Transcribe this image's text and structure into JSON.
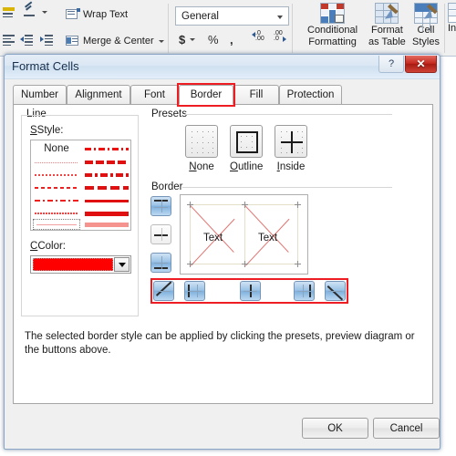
{
  "ribbon": {
    "alignment_group": {
      "orientation_label": "orientation-icon",
      "wrap_text": "Wrap Text",
      "merge_center": "Merge & Center",
      "decrease_indent": "decrease-indent-icon",
      "increase_indent": "increase-indent-icon",
      "align_left": "align-left-icon"
    },
    "number_group": {
      "format_value": "General",
      "currency": "$",
      "percent": "%",
      "comma": ",",
      "increase_decimal": ".00",
      "decrease_decimal": ".00"
    },
    "styles_group": {
      "conditional_formatting_line1": "Conditional",
      "conditional_formatting_line2": "Formatting",
      "format_as_table_line1": "Format",
      "format_as_table_line2": "as Table",
      "cell_styles_line1": "Cell",
      "cell_styles_line2": "Styles",
      "cells_group_partial": "In"
    }
  },
  "dialog": {
    "title": "Format Cells",
    "help_button": "?",
    "close_button": "✕",
    "tabs": [
      {
        "label": "Number",
        "selected": false
      },
      {
        "label": "Alignment",
        "selected": false
      },
      {
        "label": "Font",
        "selected": false
      },
      {
        "label": "Border",
        "selected": true
      },
      {
        "label": "Fill",
        "selected": false
      },
      {
        "label": "Protection",
        "selected": false
      }
    ],
    "line_group": {
      "title": "Line",
      "style_label": "Style:",
      "style_none": "None",
      "color_label": "Color:",
      "color_value": "#ff0000",
      "selected_style": "thin-solid"
    },
    "presets_group": {
      "title": "Presets",
      "buttons": [
        {
          "label": "None"
        },
        {
          "label": "Outline"
        },
        {
          "label": "Inside"
        }
      ]
    },
    "border_group": {
      "title": "Border",
      "preview_text_left": "Text",
      "preview_text_right": "Text",
      "side_buttons": [
        {
          "name": "border-top",
          "pressed": true
        },
        {
          "name": "border-horizontal",
          "pressed": false
        },
        {
          "name": "border-bottom",
          "pressed": true
        }
      ],
      "bottom_buttons": [
        {
          "name": "border-diagonal-up",
          "pressed": true
        },
        {
          "name": "border-left",
          "pressed": true
        },
        {
          "name": "border-vertical",
          "pressed": true
        },
        {
          "name": "border-right",
          "pressed": true
        },
        {
          "name": "border-diagonal-down",
          "pressed": true
        }
      ],
      "highlight_color": "#ee1d24"
    },
    "help_text": "The selected border style can be applied by clicking the presets, preview diagram or the buttons above.",
    "ok_label": "OK",
    "cancel_label": "Cancel"
  }
}
